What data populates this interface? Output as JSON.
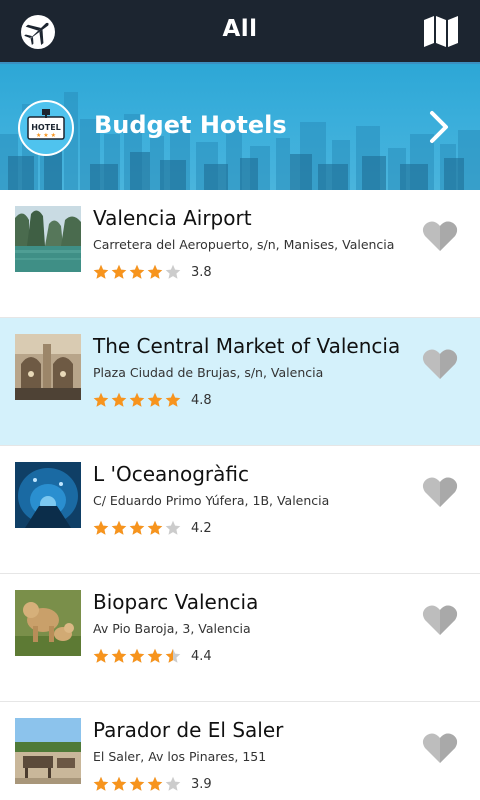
{
  "header": {
    "title": "All",
    "left_icon": "airplane-icon",
    "right_icon": "map-icon"
  },
  "banner": {
    "title": "Budget Hotels",
    "badge_text": "HOTEL",
    "badge_icon": "hotel-icon",
    "chevron_icon": "chevron-right-icon"
  },
  "colors": {
    "header_bg": "#1c2530",
    "banner_bg": "#2da7d6",
    "selected_row_bg": "#d4f1fb",
    "star_filled": "#f7941d",
    "star_empty": "#cccccc",
    "heart": "#bdbdbd"
  },
  "places": [
    {
      "name": "Valencia Airport",
      "address": "Carretera del Aeropuerto, s/n, Manises, Valencia",
      "rating": "3.8",
      "rating_value": 3.8,
      "selected": false,
      "thumb": "lake-photo"
    },
    {
      "name": "The Central Market of Valencia",
      "address": "Plaza Ciudad de Brujas, s/n, Valencia",
      "rating": "4.8",
      "rating_value": 4.8,
      "selected": true,
      "thumb": "market-photo"
    },
    {
      "name": "L 'Oceanogràfic",
      "address": "C/ Eduardo Primo Yúfera, 1B, Valencia",
      "rating": "4.2",
      "rating_value": 4.2,
      "selected": false,
      "thumb": "aquarium-tunnel-photo"
    },
    {
      "name": "Bioparc Valencia",
      "address": "Av Pio Baroja, 3, Valencia",
      "rating": "4.4",
      "rating_value": 4.4,
      "selected": false,
      "thumb": "lions-photo"
    },
    {
      "name": "Parador de El Saler",
      "address": "El Saler, Av los Pinares, 151",
      "rating": "3.9",
      "rating_value": 3.9,
      "selected": false,
      "thumb": "terrace-photo"
    }
  ]
}
